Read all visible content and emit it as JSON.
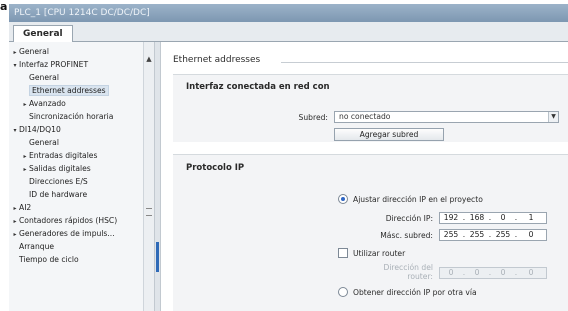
{
  "badge": "a",
  "window": {
    "title": "PLC_1 [CPU 1214C DC/DC/DC]"
  },
  "tabs": [
    {
      "label": "General"
    }
  ],
  "nav": {
    "items": [
      {
        "label": "General",
        "arrow": "▸"
      },
      {
        "label": "Interfaz PROFINET",
        "arrow": "▾"
      },
      {
        "label": "General",
        "arrow": ""
      },
      {
        "label": "Ethernet addresses",
        "arrow": ""
      },
      {
        "label": "Avanzado",
        "arrow": "▸"
      },
      {
        "label": "Sincronización horaria",
        "arrow": ""
      },
      {
        "label": "DI14/DQ10",
        "arrow": "▾"
      },
      {
        "label": "General",
        "arrow": ""
      },
      {
        "label": "Entradas digitales",
        "arrow": "▸"
      },
      {
        "label": "Salidas digitales",
        "arrow": "▸"
      },
      {
        "label": "Direcciones E/S",
        "arrow": ""
      },
      {
        "label": "ID de hardware",
        "arrow": ""
      },
      {
        "label": "AI2",
        "arrow": "▸"
      },
      {
        "label": "Contadores rápidos (HSC)",
        "arrow": "▸"
      },
      {
        "label": "Generadores de impuls...",
        "arrow": "▸"
      },
      {
        "label": "Arranque",
        "arrow": ""
      },
      {
        "label": "Tiempo de ciclo",
        "arrow": ""
      }
    ]
  },
  "content": {
    "section_title": "Ethernet addresses",
    "interface_group": {
      "title": "Interfaz conectada en red con",
      "subnet_label": "Subred:",
      "subnet_value": "no conectado",
      "add_subnet_button": "Agregar subred"
    },
    "ip_group": {
      "title": "Protocolo IP",
      "radio_project": "Ajustar dirección IP en el proyecto",
      "ip_label": "Dirección IP:",
      "ip_octets": [
        "192",
        "168",
        "0",
        "1"
      ],
      "mask_label": "Másc. subred:",
      "mask_octets": [
        "255",
        "255",
        "255",
        "0"
      ],
      "use_router": "Utilizar router",
      "router_label_1": "Dirección del",
      "router_label_2": "router:",
      "router_octets": [
        "0",
        "0",
        "0",
        "0"
      ],
      "radio_other": "Obtener dirección IP por otra vía"
    }
  }
}
